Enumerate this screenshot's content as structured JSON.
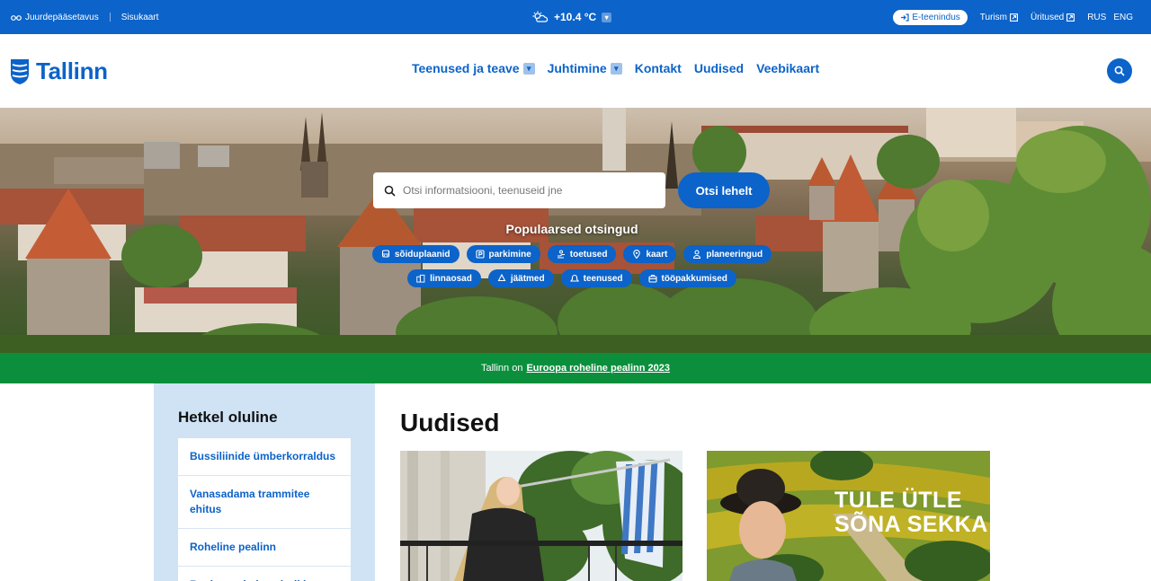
{
  "topbar": {
    "accessibility": "Juurdepääsetavus",
    "sitemap": "Sisukaart",
    "temperature": "+10.4 °C",
    "eservices": "E-teenindus",
    "tourism": "Turism",
    "events": "Üritused",
    "lang_rus": "RUS",
    "lang_eng": "ENG"
  },
  "header": {
    "logo": "Tallinn",
    "nav": [
      "Teenused ja teave",
      "Juhtimine",
      "Kontakt",
      "Uudised",
      "Veebikaart"
    ]
  },
  "hero": {
    "search_placeholder": "Otsi informatsiooni, teenuseid jne",
    "search_button": "Otsi lehelt",
    "popular_title": "Populaarsed otsingud",
    "chips_row1": [
      {
        "label": "sõiduplaanid",
        "icon": "bus-icon"
      },
      {
        "label": "parkimine",
        "icon": "parking-icon"
      },
      {
        "label": "toetused",
        "icon": "hand-icon"
      },
      {
        "label": "kaart",
        "icon": "map-pin-icon"
      },
      {
        "label": "planeeringud",
        "icon": "person-icon"
      }
    ],
    "chips_row2": [
      {
        "label": "linnaosad",
        "icon": "buildings-icon"
      },
      {
        "label": "jäätmed",
        "icon": "recycle-icon"
      },
      {
        "label": "teenused",
        "icon": "bell-icon"
      },
      {
        "label": "tööpakkumised",
        "icon": "briefcase-icon"
      }
    ]
  },
  "banner": {
    "prefix": "Tallinn on",
    "link": "Euroopa roheline pealinn 2023"
  },
  "sidebar": {
    "title": "Hetkel oluline",
    "items": [
      "Bussiliinide ümberkorraldus",
      "Vanasadama trammitee ehitus",
      "Roheline pealinn",
      "Registreerimine elurikkuse"
    ]
  },
  "news": {
    "title": "Uudised",
    "card2_text": "TULE ÜTLE\nSÕNA SEKKA"
  },
  "colors": {
    "brand_blue": "#0c63c9",
    "green": "#0b8f3c",
    "sidebar_bg": "#cfe3f5"
  }
}
